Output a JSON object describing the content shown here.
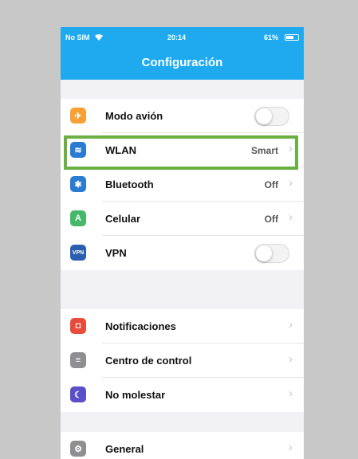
{
  "status_bar": {
    "carrier": "No SIM",
    "wifi_icon": "wifi-icon",
    "time": "20:14",
    "battery_text": "61%",
    "battery_level": 0.61
  },
  "header": {
    "title": "Configuración",
    "color": "#1faaf0"
  },
  "highlight_color": "#6ab042",
  "groups": [
    {
      "items": [
        {
          "label": "Modo avión",
          "icon": "airplane-icon",
          "icon_color": "#f7a033",
          "glyph": "✈",
          "control": "toggle",
          "on": false
        },
        {
          "label": "WLAN",
          "icon": "wifi-icon",
          "icon_color": "#2a7bd1",
          "glyph": "≋",
          "control": "value",
          "value": "Smart",
          "highlighted": true
        },
        {
          "label": "Bluetooth",
          "icon": "bluetooth-icon",
          "icon_color": "#2a7bd1",
          "glyph": "✱",
          "control": "value",
          "value": "Off"
        },
        {
          "label": "Celular",
          "icon": "cellular-icon",
          "icon_color": "#45b86a",
          "glyph": "A",
          "control": "value",
          "value": "Off"
        },
        {
          "label": "VPN",
          "icon": "vpn-icon",
          "icon_color": "#2a5fb0",
          "glyph": "VPN",
          "control": "toggle",
          "on": false
        }
      ]
    },
    {
      "items": [
        {
          "label": "Notificaciones",
          "icon": "notifications-icon",
          "icon_color": "#e84b3c",
          "glyph": "◘",
          "control": "chevron"
        },
        {
          "label": "Centro de control",
          "icon": "control-center-icon",
          "icon_color": "#8e8e93",
          "glyph": "≡",
          "control": "chevron"
        },
        {
          "label": "No molestar",
          "icon": "moon-icon",
          "icon_color": "#5a4fc8",
          "glyph": "☾",
          "control": "chevron"
        }
      ]
    },
    {
      "items": [
        {
          "label": "General",
          "icon": "gear-icon",
          "icon_color": "#8e8e93",
          "glyph": "⚙",
          "control": "chevron"
        }
      ]
    }
  ]
}
